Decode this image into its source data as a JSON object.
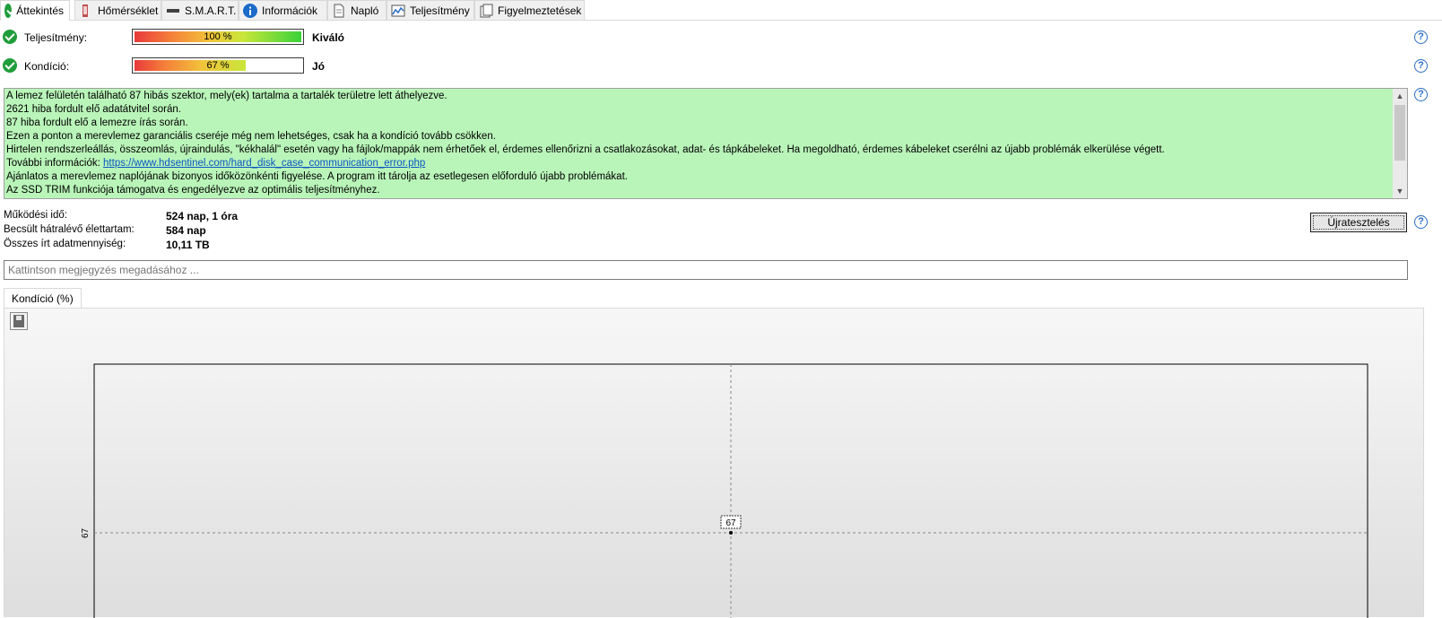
{
  "tabs": [
    {
      "label": "Áttekintés",
      "icon": "check-circle-icon"
    },
    {
      "label": "Hőmérséklet",
      "icon": "thermometer-icon"
    },
    {
      "label": "S.M.A.R.T.",
      "icon": "disk-icon"
    },
    {
      "label": "Információk",
      "icon": "info-icon"
    },
    {
      "label": "Napló",
      "icon": "document-icon"
    },
    {
      "label": "Teljesítmény",
      "icon": "chart-icon"
    },
    {
      "label": "Figyelmeztetések",
      "icon": "warning-doc-icon"
    }
  ],
  "status": {
    "performance": {
      "label": "Teljesítmény:",
      "percent_text": "100 %",
      "percent": 100,
      "rating": "Kiváló"
    },
    "health": {
      "label": "Kondíció:",
      "percent_text": "67 %",
      "percent": 67,
      "rating": "Jó"
    }
  },
  "messages": [
    "A lemez felületén található 87 hibás szektor, mely(ek) tartalma a tartalék területre lett áthelyezve.",
    "2621 hiba fordult elő adatátvitel során.",
    "87 hiba fordult elő a lemezre írás során.",
    "Ezen a ponton a merevlemez garanciális cseréje még nem lehetséges, csak ha a kondíció tovább csökken.",
    "Hirtelen rendszerleállás, összeomlás, újraindulás, \"kékhalál\" esetén vagy ha fájlok/mappák nem érhetőek el, érdemes ellenőrizni a csatlakozásokat, adat- és tápkábeleket. Ha megoldható, érdemes kábeleket cserélni az újabb problémák elkerülése végett.",
    "Ajánlatos a merevlemez naplójának bizonyos időközönkénti figyelése. A program itt tárolja az esetlegesen előforduló újabb problémákat.",
    "Az SSD TRIM funkciója támogatva és engedélyezve az optimális teljesítményhez."
  ],
  "more_info": {
    "prefix": "További információk:",
    "link": "https://www.hdsentinel.com/hard_disk_case_communication_error.php"
  },
  "stats": [
    {
      "label": "Működési idő:",
      "value": "524 nap, 1 óra"
    },
    {
      "label": "Becsült hátralévő élettartam:",
      "value": "584 nap"
    },
    {
      "label": "Összes írt adatmennyiség:",
      "value": "10,11 TB"
    }
  ],
  "retest_button": "Újratesztelés",
  "note_placeholder": "Kattintson megjegyzés megadásához ...",
  "chart_tab_label": "Kondíció  (%)",
  "chart_data": {
    "type": "line",
    "title": "",
    "ylabel": "",
    "xlabel": "",
    "y_tick_labels": [
      "67"
    ],
    "points": [
      {
        "x": 0.5,
        "y": 67,
        "label": "67"
      }
    ]
  },
  "colors": {
    "message_bg": "#b9f5b9",
    "link": "#0a56c2",
    "ok_green": "#1f9d3a",
    "help_blue": "#2a6cc2"
  }
}
